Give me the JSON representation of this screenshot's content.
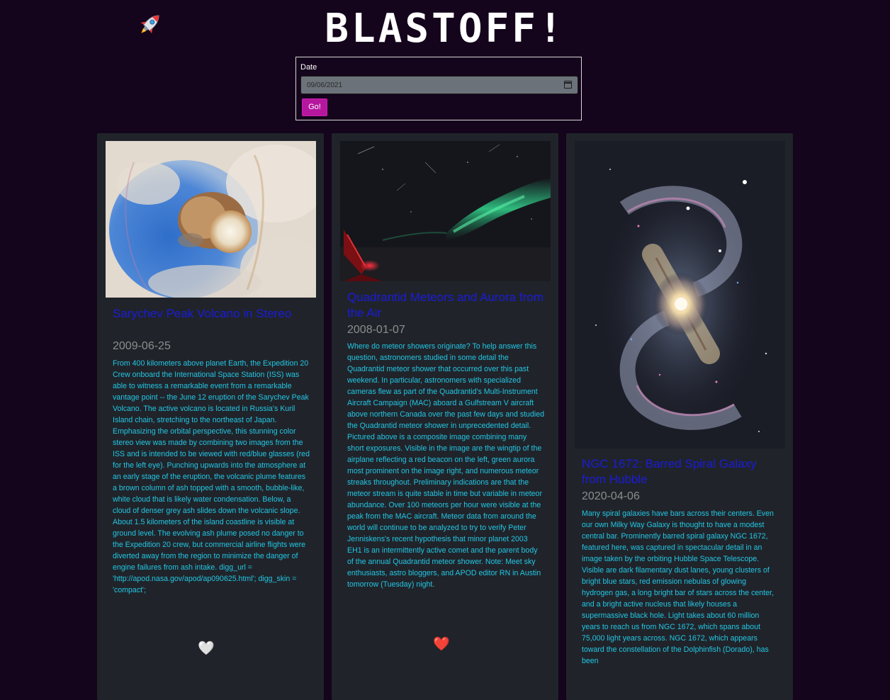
{
  "header": {
    "title": "BLASTOFF!",
    "logo_icon": "rocket-icon"
  },
  "date_form": {
    "label": "Date",
    "value": "09/06/2021",
    "submit_label": "Go!",
    "calendar_icon": "calendar-icon"
  },
  "cards": [
    {
      "title": "Sarychev Peak Volcano in Stereo",
      "date": "2009-06-25",
      "explanation": "From 400 kilometers above planet Earth, the Expedition 20 Crew onboard the International Space Station (ISS) was able to witness a remarkable event from a remarkable vantage point -- the June 12 eruption of the Sarychev Peak Volcano. The active volcano is located in Russia's Kuril Island chain, stretching to the northeast of Japan. Emphasizing the orbital perspective, this stunning color stereo view was made by combining two images from the ISS and is intended to be viewed with red/blue glasses (red for the left eye). Punching upwards into the atmosphere at an early stage of the eruption, the volcanic plume features a brown column of ash topped with a smooth, bubble-like, white cloud that is likely water condensation. Below, a cloud of denser grey ash slides down the volcanic slope. About 1.5 kilometers of the island coastline is visible at ground level. The evolving ash plume posed no danger to the Expedition 20 crew, but commercial airline flights were diverted away from the region to minimize the danger of engine failures from ash intake. digg_url = 'http://apod.nasa.gov/apod/ap090625.html'; digg_skin = 'compact';",
      "liked": false,
      "like_icon": "white-heart-icon",
      "like_glyph": "🤍"
    },
    {
      "title": "Quadrantid Meteors and Aurora from the Air",
      "date": "2008-01-07",
      "explanation": "Where do meteor showers originate? To help answer this question, astronomers studied in some detail the Quadrantid meteor shower that occurred over this past weekend. In particular, astronomers with specialized cameras flew as part of the Quadrantid's Multi-Instrument Aircraft Campaign (MAC) aboard a Gulfstream V aircraft above northern Canada over the past few days and studied the Quadrantid meteor shower in unprecedented detail. Pictured above is a composite image combining many short exposures. Visible in the image are the wingtip of the airplane reflecting a red beacon on the left, green aurora most prominent on the image right, and numerous meteor streaks throughout. Preliminary indications are that the meteor stream is quite stable in time but variable in meteor abundance. Over 100 meteors per hour were visible at the peak from the MAC aircraft. Meteor data from around the world will continue to be analyzed to try to verify Peter Jenniskens's recent hypothesis that minor planet 2003 EH1 is an intermittently active comet and the parent body of the annual Quadrantid meteor shower. Note: Meet sky enthusiasts, astro bloggers, and APOD editor RN in Austin tomorrow (Tuesday) night.",
      "liked": true,
      "like_icon": "red-heart-icon",
      "like_glyph": "❤️"
    },
    {
      "title": "NGC 1672: Barred Spiral Galaxy from Hubble",
      "date": "2020-04-06",
      "explanation": "Many spiral galaxies have bars across their centers. Even our own Milky Way Galaxy is thought to have a modest central bar. Prominently barred spiral galaxy NGC 1672, featured here, was captured in spectacular detail in an image taken by the orbiting Hubble Space Telescope. Visible are dark filamentary dust lanes, young clusters of bright blue stars, red emission nebulas of glowing hydrogen gas, a long bright bar of stars across the center, and a bright active nucleus that likely houses a supermassive black hole. Light takes about 60 million years to reach us from NGC 1672, which spans about 75,000 light years across. NGC 1672, which appears toward the constellation of the Dolphinfish (Dorado), has been",
      "liked": false,
      "like_icon": "",
      "like_glyph": ""
    }
  ]
}
